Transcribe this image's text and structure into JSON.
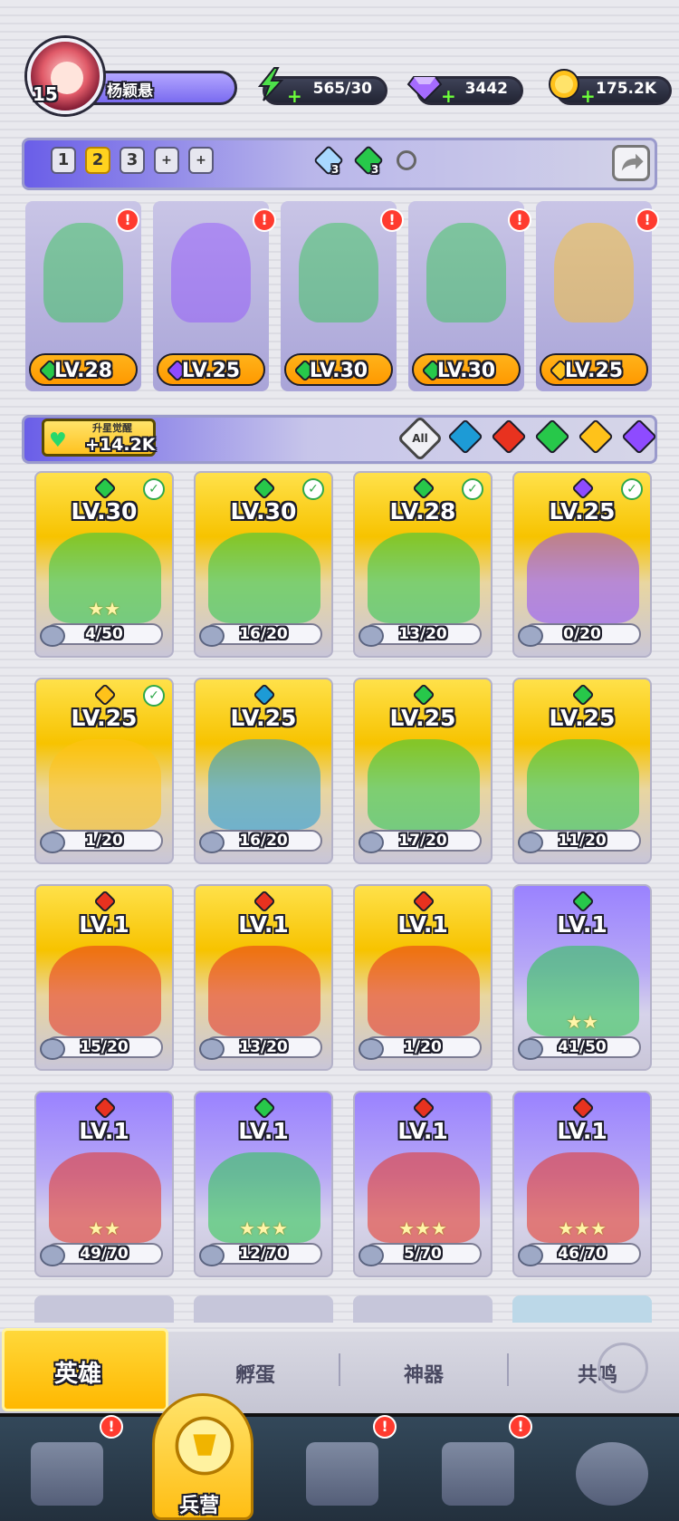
{
  "player": {
    "level": "15",
    "name": "杨颖悬"
  },
  "resources": {
    "energy": "565/30",
    "gems": "3442",
    "gold": "175.2K"
  },
  "team_tabs": [
    "1",
    "2",
    "3",
    "+",
    "+"
  ],
  "team_counts": {
    "a": "3",
    "b": "3"
  },
  "team_heroes": [
    {
      "level": "LV.28",
      "element": "nature"
    },
    {
      "level": "LV.25",
      "element": "dark"
    },
    {
      "level": "LV.30",
      "element": "nature"
    },
    {
      "level": "LV.30",
      "element": "nature"
    },
    {
      "level": "LV.25",
      "element": "light"
    }
  ],
  "bonus": {
    "label": "升星觉醒",
    "value": "+14.2K"
  },
  "filter": {
    "all_label": "All",
    "elements": [
      "water",
      "fire",
      "nature",
      "light",
      "dark"
    ]
  },
  "heroes": [
    {
      "level": "LV.30",
      "progress": "4/50",
      "element": "nature",
      "theme": "gold",
      "checked": true,
      "stars": 2
    },
    {
      "level": "LV.30",
      "progress": "16/20",
      "element": "nature",
      "theme": "gold",
      "checked": true,
      "stars": 0
    },
    {
      "level": "LV.28",
      "progress": "13/20",
      "element": "nature",
      "theme": "gold",
      "checked": true,
      "stars": 0
    },
    {
      "level": "LV.25",
      "progress": "0/20",
      "element": "dark",
      "theme": "gold",
      "checked": true,
      "stars": 0
    },
    {
      "level": "LV.25",
      "progress": "1/20",
      "element": "light",
      "theme": "gold",
      "checked": true,
      "stars": 0
    },
    {
      "level": "LV.25",
      "progress": "16/20",
      "element": "water",
      "theme": "gold",
      "checked": false,
      "stars": 0
    },
    {
      "level": "LV.25",
      "progress": "17/20",
      "element": "nature",
      "theme": "gold",
      "checked": false,
      "stars": 0
    },
    {
      "level": "LV.25",
      "progress": "11/20",
      "element": "nature",
      "theme": "gold",
      "checked": false,
      "stars": 0
    },
    {
      "level": "LV.1",
      "progress": "15/20",
      "element": "fire",
      "theme": "gold",
      "checked": false,
      "stars": 0
    },
    {
      "level": "LV.1",
      "progress": "13/20",
      "element": "fire",
      "theme": "gold",
      "checked": false,
      "stars": 0
    },
    {
      "level": "LV.1",
      "progress": "1/20",
      "element": "fire",
      "theme": "gold",
      "checked": false,
      "stars": 0
    },
    {
      "level": "LV.1",
      "progress": "41/50",
      "element": "nature",
      "theme": "purple",
      "checked": false,
      "stars": 2
    },
    {
      "level": "LV.1",
      "progress": "49/70",
      "element": "fire",
      "theme": "purple",
      "checked": false,
      "stars": 2
    },
    {
      "level": "LV.1",
      "progress": "12/70",
      "element": "nature",
      "theme": "purple",
      "checked": false,
      "stars": 3
    },
    {
      "level": "LV.1",
      "progress": "5/70",
      "element": "fire",
      "theme": "purple",
      "checked": false,
      "stars": 3
    },
    {
      "level": "LV.1",
      "progress": "46/70",
      "element": "fire",
      "theme": "purple",
      "checked": false,
      "stars": 3
    }
  ],
  "subtabs": [
    "英雄",
    "孵蛋",
    "神器",
    "共鸣"
  ],
  "nav": {
    "barracks_label": "兵营"
  },
  "colors": {
    "nature": "#27c84a",
    "dark": "#8e4bff",
    "light": "#ffc21a",
    "water": "#1d9bd6",
    "fire": "#e8321f",
    "accent": "#ffd21f"
  }
}
